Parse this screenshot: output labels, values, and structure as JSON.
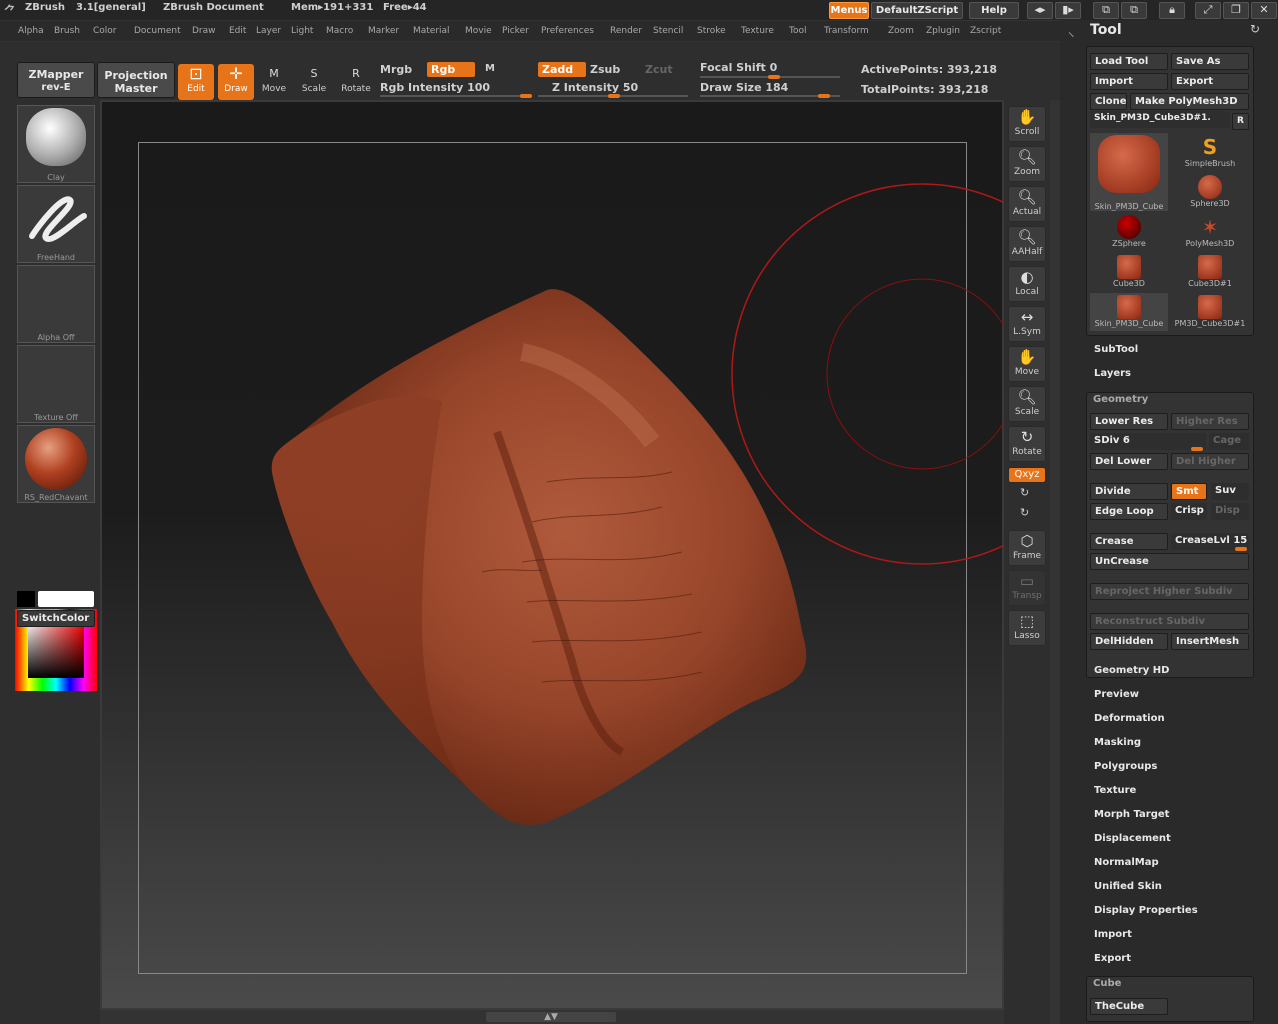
{
  "title_bar": {
    "app": "ZBrush",
    "version": "3.1[general]",
    "document": "ZBrush Document",
    "mem": "Mem▸191+331",
    "free": "Free▸44",
    "menus_btn": "Menus",
    "script_btn": "DefaultZScript",
    "help_btn": "Help"
  },
  "menu": [
    "Alpha",
    "Brush",
    "Color",
    "Document",
    "Draw",
    "Edit",
    "Layer",
    "Light",
    "Macro",
    "Marker",
    "Material",
    "Movie",
    "Picker",
    "Preferences",
    "Render",
    "Stencil",
    "Stroke",
    "Texture",
    "Tool",
    "Transform",
    "Zoom",
    "Zplugin",
    "Zscript"
  ],
  "toolbar": {
    "zmapper": "ZMapper",
    "zmapper_sub": "rev-E",
    "projection": "Projection",
    "projection_sub": "Master",
    "edit": "Edit",
    "draw": "Draw",
    "move": "Move",
    "scale": "Scale",
    "rotate": "Rotate",
    "move_key": "M",
    "scale_key": "S",
    "rotate_key": "R",
    "mrgb": "Mrgb",
    "rgb": "Rgb",
    "m": "M",
    "rgb_intensity": "Rgb Intensity 100",
    "zadd": "Zadd",
    "zsub": "Zsub",
    "zcut": "Zcut",
    "z_intensity": "Z Intensity 50",
    "focal_shift": "Focal Shift 0",
    "draw_size": "Draw Size 184",
    "active_points": "ActivePoints: 393,218",
    "total_points": "TotalPoints: 393,218"
  },
  "left_shelf": {
    "brush": "Clay",
    "stroke": "FreeHand",
    "alpha": "Alpha Off",
    "texture": "Texture Off",
    "material": "RS_RedChavant",
    "switch_color": "SwitchColor"
  },
  "right_shelf": [
    "Scroll",
    "Zoom",
    "Actual",
    "AAHalf",
    "Local",
    "L.Sym",
    "Move",
    "Scale",
    "Rotate",
    "Frame",
    "Transp",
    "Lasso"
  ],
  "right_shelf_extra": {
    "xyz": "Qxyz"
  },
  "tool": {
    "header": "Tool",
    "load": "Load Tool",
    "save": "Save As",
    "import": "Import",
    "export": "Export",
    "clone": "Clone",
    "make_polymesh": "Make PolyMesh3D",
    "current": "Skin_PM3D_Cube3D#1.",
    "r": "R",
    "tiles": [
      "Skin_PM3D_Cube",
      "SimpleBrush",
      "Sphere3D",
      "ZSphere",
      "PolyMesh3D",
      "Cube3D",
      "Cube3D#1",
      "Skin_PM3D_Cube",
      "PM3D_Cube3D#1"
    ],
    "subtool": "SubTool",
    "layers": "Layers",
    "geometry": "Geometry",
    "geo": {
      "lower_res": "Lower Res",
      "higher_res": "Higher Res",
      "sdiv": "SDiv 6",
      "cage": "Cage",
      "del_lower": "Del Lower",
      "del_higher": "Del Higher",
      "divide": "Divide",
      "smt": "Smt",
      "suv": "Suv",
      "edge_loop": "Edge Loop",
      "crisp": "Crisp",
      "disp": "Disp",
      "crease": "Crease",
      "crease_lvl": "CreaseLvl 15",
      "uncrease": "UnCrease",
      "reproject": "Reproject Higher Subdiv",
      "reconstruct": "Reconstruct Subdiv",
      "del_hidden": "DelHidden",
      "insert_mesh": "InsertMesh"
    },
    "sections": [
      "Geometry HD",
      "Preview",
      "Deformation",
      "Masking",
      "Polygroups",
      "Texture",
      "Morph Target",
      "Displacement",
      "NormalMap",
      "Unified Skin",
      "Display Properties",
      "Import",
      "Export"
    ],
    "cube_header": "Cube",
    "thecube": "TheCube"
  },
  "colors": {
    "accent": "#e8741a",
    "model": "#9a4028",
    "brush_circle": "#b01818"
  }
}
